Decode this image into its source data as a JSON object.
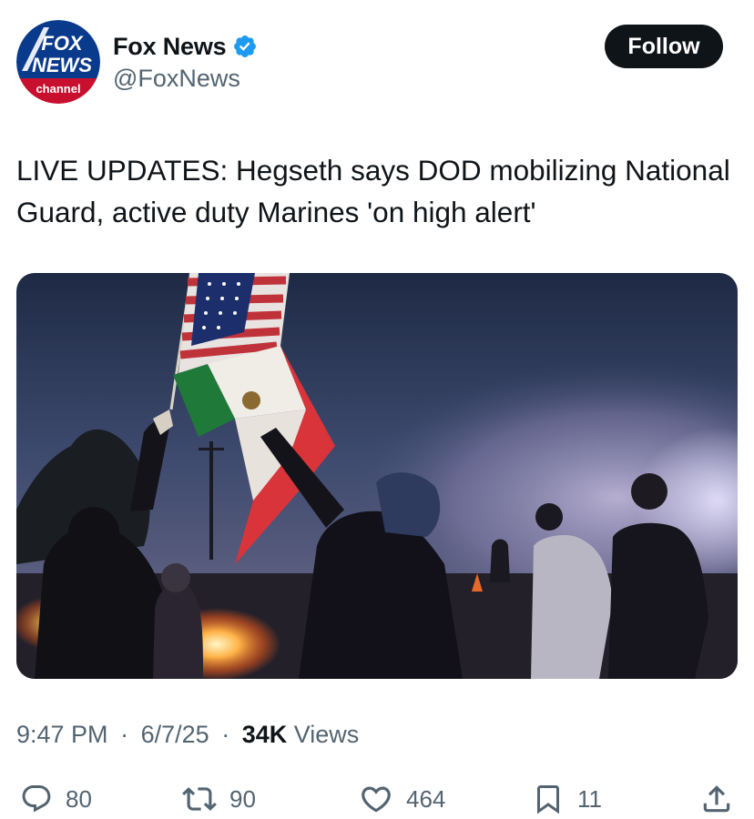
{
  "account": {
    "display_name": "Fox News",
    "handle": "@FoxNews",
    "verified": true,
    "logo_text_1": "FOX",
    "logo_text_2": "NEWS",
    "logo_text_3": "channel"
  },
  "follow_button_label": "Follow",
  "tweet": {
    "text": "LIVE UPDATES: Hegseth says DOD mobilizing National Guard, active duty Marines 'on high alert'",
    "media_description": "Protesters at night waving American and Mexican flags near fire and smoke"
  },
  "meta": {
    "time": "9:47 PM",
    "date": "6/7/25",
    "views_count": "34K",
    "views_label": "Views",
    "separator": "·"
  },
  "actions": {
    "replies": "80",
    "reposts": "90",
    "likes": "464",
    "bookmarks": "11"
  },
  "colors": {
    "text_primary": "#0f1419",
    "text_secondary": "#536471",
    "verified_blue": "#1d9bf0",
    "follow_bg": "#0f1419",
    "fox_red": "#c8102e",
    "fox_blue": "#0a3a8c"
  },
  "icons": {
    "reply": "speech-bubble-icon",
    "repost": "repost-arrows-icon",
    "like": "heart-icon",
    "bookmark": "bookmark-icon",
    "share": "share-upload-icon",
    "verified": "verified-badge-icon"
  }
}
